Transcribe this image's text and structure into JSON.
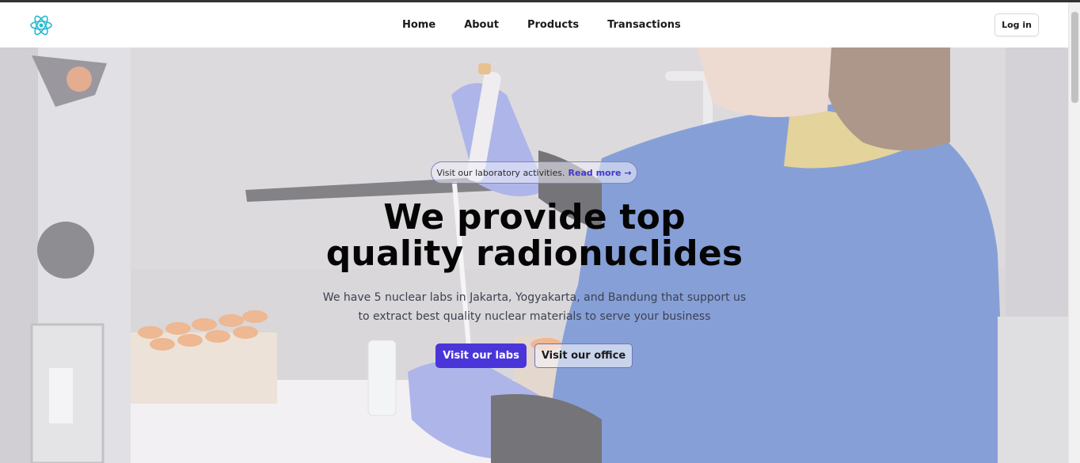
{
  "nav": {
    "links": [
      "Home",
      "About",
      "Products",
      "Transactions"
    ],
    "login_label": "Log in",
    "logo_icon": "react-atom-icon"
  },
  "hero": {
    "announcement_text": "Visit our laboratory activities.",
    "announcement_link": "Read more →",
    "headline_line1": "We provide top",
    "headline_line2": "quality radionuclides",
    "subtitle_line1": "We have 5 nuclear labs in Jakarta, Yogyakarta, and Bandung that support us",
    "subtitle_line2": "to extract best quality nuclear materials to serve your business",
    "primary_button": "Visit our labs",
    "secondary_button": "Visit our office",
    "background_image": "laboratory-photo"
  },
  "colors": {
    "accent": "#4a36d8",
    "logo": "#22b8cf",
    "link": "#4338ca"
  }
}
